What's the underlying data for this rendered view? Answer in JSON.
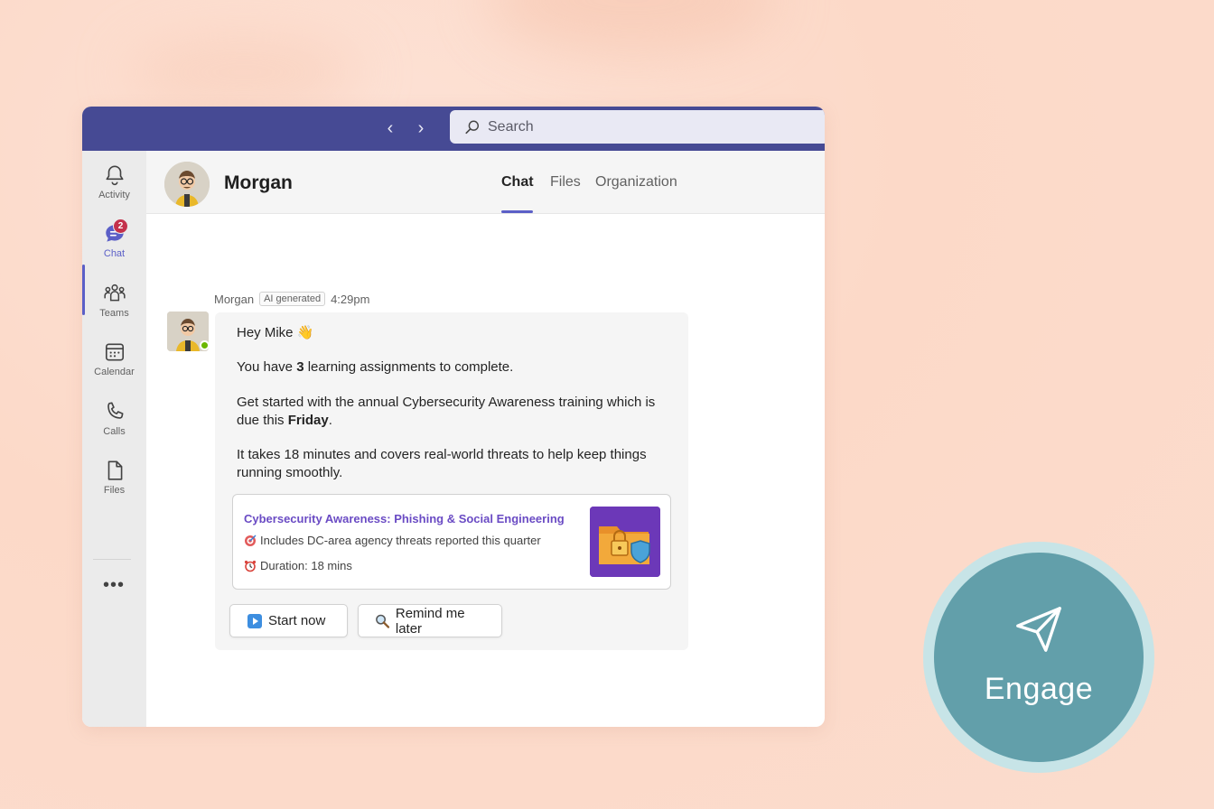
{
  "search": {
    "placeholder": "Search"
  },
  "rail": {
    "items": [
      {
        "label": "Activity",
        "icon": "bell-icon"
      },
      {
        "label": "Chat",
        "icon": "chat-icon",
        "badge": "2"
      },
      {
        "label": "Teams",
        "icon": "teams-icon"
      },
      {
        "label": "Calendar",
        "icon": "calendar-icon"
      },
      {
        "label": "Calls",
        "icon": "phone-icon"
      },
      {
        "label": "Files",
        "icon": "file-icon"
      }
    ],
    "more": "•••"
  },
  "header": {
    "name": "Morgan",
    "tabs": [
      "Chat",
      "Files",
      "Organization"
    ]
  },
  "message": {
    "sender": "Morgan",
    "tag": "AI generated",
    "time": "4:29pm",
    "greeting": "Hey Mike 👋",
    "line1_pre": "You have ",
    "line1_bold": "3",
    "line1_post": " learning assignments to complete.",
    "line2_pre": "Get started with the annual Cybersecurity Awareness training which is due this ",
    "line2_bold": "Friday",
    "line2_post": ".",
    "line3": "It takes 18 minutes and covers real-world threats to help keep things running smoothly."
  },
  "card": {
    "title": "Cybersecurity Awareness: Phishing & Social Engineering",
    "detail": "Includes DC-area agency threats reported this quarter",
    "duration": "Duration: 18 mins"
  },
  "buttons": {
    "start": "Start now",
    "remind": "Remind me later"
  },
  "engage": {
    "label": "Engage"
  },
  "colors": {
    "titlebar": "#464a94",
    "accent": "#5b5fc7",
    "card_title": "#6a4bc4",
    "engage": "#629faa"
  }
}
